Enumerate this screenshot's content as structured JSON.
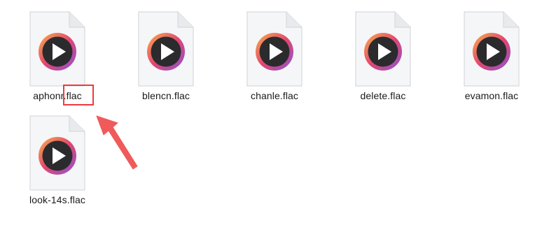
{
  "files": [
    {
      "name": "aphonr.flac",
      "icon": "media-player-icon"
    },
    {
      "name": "blencn.flac",
      "icon": "media-player-icon"
    },
    {
      "name": "chanle.flac",
      "icon": "media-player-icon"
    },
    {
      "name": "delete.flac",
      "icon": "media-player-icon"
    },
    {
      "name": "evamon.flac",
      "icon": "media-player-icon"
    },
    {
      "name": "look-14s.flac",
      "icon": "media-player-icon"
    }
  ],
  "annotation": {
    "highlight_color": "#ee3b3b",
    "arrow_color": "#f05a5a",
    "target": "file extension of aphonr.flac"
  },
  "colors": {
    "page_bg": "#ffffff",
    "doc_bg": "#f4f5f7",
    "ring_gradient": [
      "#f7a14b",
      "#e34a6f",
      "#8e4fd3"
    ]
  }
}
